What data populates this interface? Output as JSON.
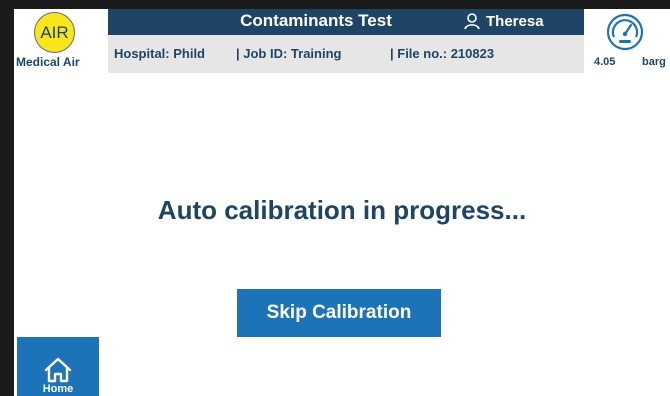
{
  "header": {
    "title": "Contaminants Test",
    "user": "Theresa"
  },
  "info": {
    "hospital": "Hospital: Phild",
    "job": "| Job ID:  Training",
    "file": "| File no.: 210823"
  },
  "gas": {
    "code": "AIR",
    "name": "Medical Air",
    "badge_color": "#f8e61a"
  },
  "pressure": {
    "value": "4.05",
    "unit": "barg",
    "icon": "gauge-icon"
  },
  "main": {
    "status": "Auto calibration in progress...",
    "skip_label": "Skip Calibration"
  },
  "nav": {
    "home_label": "Home",
    "home_icon": "home-icon"
  },
  "colors": {
    "navy": "#1e4466",
    "accent_blue": "#1d73b8",
    "info_bar": "#e6e6e6"
  }
}
